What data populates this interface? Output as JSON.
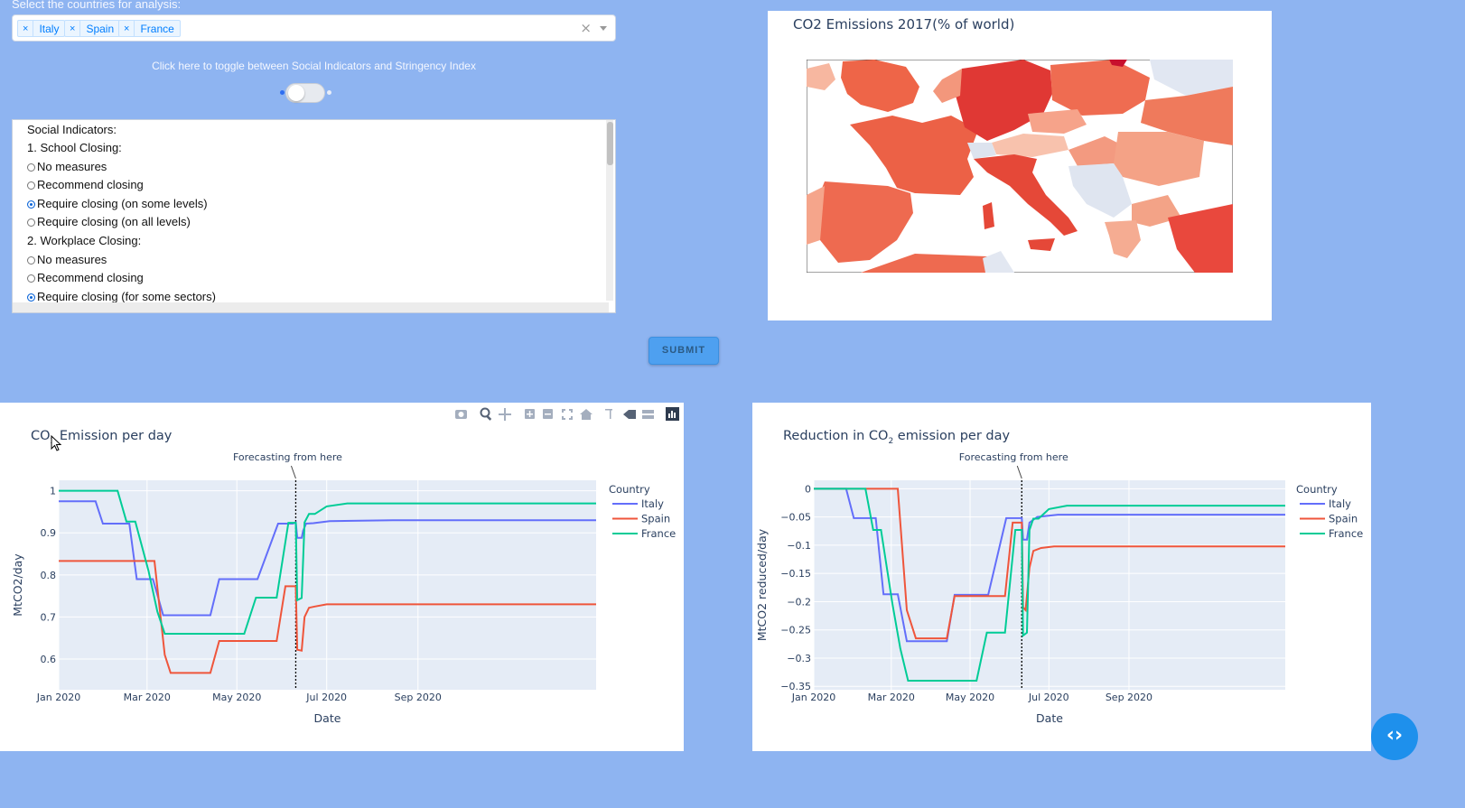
{
  "country_select": {
    "label": "Select the countries for analysis:",
    "tags": [
      "Italy",
      "Spain",
      "France"
    ],
    "remove_glyph": "×",
    "clear_glyph": "×"
  },
  "toggle": {
    "label": "Click here to toggle between Social Indicators and Stringency Index",
    "on": false
  },
  "indicators": {
    "heading": "Social Indicators:",
    "groups": [
      {
        "title": "1. School Closing:",
        "options": [
          "No measures",
          "Recommend closing",
          "Require closing (on some levels)",
          "Require closing (on all levels)"
        ],
        "selected": 2
      },
      {
        "title": "2. Workplace Closing:",
        "options": [
          "No measures",
          "Recommend closing",
          "Require closing (for some sectors)"
        ],
        "selected": 2
      }
    ]
  },
  "submit_label": "SUBMIT",
  "map": {
    "title": "CO2 Emissions 2017(% of world)",
    "colorscale": [
      "#fbe0d4",
      "#f7a98d",
      "#f06a50",
      "#e03b32"
    ]
  },
  "toolbar_icons": [
    "camera-icon",
    "zoom-icon",
    "pan-icon",
    "zoom-in-icon",
    "zoom-out-icon",
    "autoscale-icon",
    "home-icon",
    "spike-lines-icon",
    "hover-closest-icon",
    "hover-compare-icon",
    "plotly-logo-icon"
  ],
  "fab_label": "‹›",
  "chart_data": [
    {
      "type": "line",
      "title_pre": "CO",
      "title_sub": "2",
      "title_post": " Emission per day",
      "xlabel": "Date",
      "ylabel": "MtCO2/day",
      "xlim": [
        "2020-01-01",
        "2020-12-31"
      ],
      "ylim": [
        0.527,
        1.025
      ],
      "yticks": [
        0.6,
        0.7,
        0.8,
        0.9,
        1
      ],
      "ytick_labels": [
        "0.6",
        "0.7",
        "0.8",
        "0.9",
        "1"
      ],
      "xticks": [
        "2020-01-01",
        "2020-03-01",
        "2020-05-01",
        "2020-07-01",
        "2020-09-01"
      ],
      "xtick_labels": [
        "Jan 2020",
        "Mar 2020",
        "May 2020",
        "Jul 2020",
        "Sep 2020"
      ],
      "annotation": {
        "text": "Forecasting from here",
        "x": "2020-06-10"
      },
      "legend_title": "Country",
      "legend_position": "top-right",
      "series": [
        {
          "name": "Italy",
          "color": "#636efa",
          "points": [
            [
              "2020-01-01",
              0.975
            ],
            [
              "2020-01-26",
              0.975
            ],
            [
              "2020-01-31",
              0.922
            ],
            [
              "2020-02-18",
              0.922
            ],
            [
              "2020-02-23",
              0.79
            ],
            [
              "2020-03-05",
              0.79
            ],
            [
              "2020-03-12",
              0.704
            ],
            [
              "2020-04-13",
              0.704
            ],
            [
              "2020-04-19",
              0.79
            ],
            [
              "2020-05-15",
              0.79
            ],
            [
              "2020-05-29",
              0.922
            ],
            [
              "2020-06-08",
              0.922
            ],
            [
              "2020-06-10",
              0.925
            ],
            [
              "2020-06-11",
              0.888
            ],
            [
              "2020-06-14",
              0.888
            ],
            [
              "2020-06-15",
              0.905
            ],
            [
              "2020-06-17",
              0.922
            ],
            [
              "2020-06-22",
              0.923
            ],
            [
              "2020-07-03",
              0.928
            ],
            [
              "2020-08-15",
              0.93
            ],
            [
              "2020-12-31",
              0.93
            ]
          ]
        },
        {
          "name": "Spain",
          "color": "#ef553b",
          "points": [
            [
              "2020-01-01",
              0.833
            ],
            [
              "2020-03-06",
              0.833
            ],
            [
              "2020-03-13",
              0.61
            ],
            [
              "2020-03-17",
              0.567
            ],
            [
              "2020-04-13",
              0.567
            ],
            [
              "2020-04-19",
              0.643
            ],
            [
              "2020-05-28",
              0.643
            ],
            [
              "2020-06-03",
              0.773
            ],
            [
              "2020-06-10",
              0.773
            ],
            [
              "2020-06-11",
              0.622
            ],
            [
              "2020-06-14",
              0.62
            ],
            [
              "2020-06-16",
              0.7
            ],
            [
              "2020-06-19",
              0.722
            ],
            [
              "2020-06-23",
              0.725
            ],
            [
              "2020-07-01",
              0.73
            ],
            [
              "2020-12-31",
              0.73
            ]
          ]
        },
        {
          "name": "France",
          "color": "#00cc96",
          "points": [
            [
              "2020-01-01",
              1.0
            ],
            [
              "2020-02-10",
              1.0
            ],
            [
              "2020-02-16",
              0.927
            ],
            [
              "2020-02-22",
              0.927
            ],
            [
              "2020-03-02",
              0.81
            ],
            [
              "2020-03-08",
              0.713
            ],
            [
              "2020-03-13",
              0.66
            ],
            [
              "2020-05-06",
              0.66
            ],
            [
              "2020-05-14",
              0.746
            ],
            [
              "2020-05-28",
              0.746
            ],
            [
              "2020-06-05",
              0.924
            ],
            [
              "2020-06-10",
              0.924
            ],
            [
              "2020-06-11",
              0.74
            ],
            [
              "2020-06-14",
              0.745
            ],
            [
              "2020-06-16",
              0.925
            ],
            [
              "2020-06-19",
              0.945
            ],
            [
              "2020-06-23",
              0.945
            ],
            [
              "2020-07-01",
              0.963
            ],
            [
              "2020-07-15",
              0.97
            ],
            [
              "2020-12-31",
              0.97
            ]
          ]
        }
      ]
    },
    {
      "type": "line",
      "title_pre": "Reduction in CO",
      "title_sub": "2",
      "title_post": " emission per day",
      "xlabel": "Date",
      "ylabel": "MtCO2 reduced/day",
      "xlim": [
        "2020-01-01",
        "2020-12-31"
      ],
      "ylim": [
        -0.356,
        0.015
      ],
      "yticks": [
        -0.35,
        -0.3,
        -0.25,
        -0.2,
        -0.15,
        -0.1,
        -0.05,
        0
      ],
      "ytick_labels": [
        "−0.35",
        "−0.3",
        "−0.25",
        "−0.2",
        "−0.15",
        "−0.1",
        "−0.05",
        "0"
      ],
      "xticks": [
        "2020-01-01",
        "2020-03-01",
        "2020-05-01",
        "2020-07-01",
        "2020-09-01"
      ],
      "xtick_labels": [
        "Jan 2020",
        "Mar 2020",
        "May 2020",
        "Jul 2020",
        "Sep 2020"
      ],
      "annotation": {
        "text": "Forecasting from here",
        "x": "2020-06-10"
      },
      "legend_title": "Country",
      "legend_position": "top-right",
      "series": [
        {
          "name": "Italy",
          "color": "#636efa",
          "points": [
            [
              "2020-01-01",
              0
            ],
            [
              "2020-01-26",
              0
            ],
            [
              "2020-02-01",
              -0.052
            ],
            [
              "2020-02-18",
              -0.052
            ],
            [
              "2020-02-24",
              -0.187
            ],
            [
              "2020-03-06",
              -0.187
            ],
            [
              "2020-03-13",
              -0.27
            ],
            [
              "2020-04-13",
              -0.27
            ],
            [
              "2020-04-19",
              -0.188
            ],
            [
              "2020-05-15",
              -0.188
            ],
            [
              "2020-05-29",
              -0.052
            ],
            [
              "2020-06-10",
              -0.052
            ],
            [
              "2020-06-11",
              -0.09
            ],
            [
              "2020-06-14",
              -0.09
            ],
            [
              "2020-06-16",
              -0.06
            ],
            [
              "2020-06-22",
              -0.05
            ],
            [
              "2020-07-08",
              -0.046
            ],
            [
              "2020-12-31",
              -0.046
            ]
          ]
        },
        {
          "name": "Spain",
          "color": "#ef553b",
          "points": [
            [
              "2020-01-01",
              0
            ],
            [
              "2020-03-06",
              0
            ],
            [
              "2020-03-13",
              -0.215
            ],
            [
              "2020-03-20",
              -0.265
            ],
            [
              "2020-04-13",
              -0.265
            ],
            [
              "2020-04-19",
              -0.19
            ],
            [
              "2020-05-28",
              -0.19
            ],
            [
              "2020-06-03",
              -0.06
            ],
            [
              "2020-06-10",
              -0.06
            ],
            [
              "2020-06-11",
              -0.21
            ],
            [
              "2020-06-13",
              -0.215
            ],
            [
              "2020-06-16",
              -0.14
            ],
            [
              "2020-06-19",
              -0.11
            ],
            [
              "2020-06-25",
              -0.105
            ],
            [
              "2020-07-05",
              -0.102
            ],
            [
              "2020-12-31",
              -0.102
            ]
          ]
        },
        {
          "name": "France",
          "color": "#00cc96",
          "points": [
            [
              "2020-01-01",
              0
            ],
            [
              "2020-02-10",
              0
            ],
            [
              "2020-02-16",
              -0.073
            ],
            [
              "2020-02-22",
              -0.073
            ],
            [
              "2020-03-02",
              -0.205
            ],
            [
              "2020-03-08",
              -0.283
            ],
            [
              "2020-03-14",
              -0.34
            ],
            [
              "2020-05-06",
              -0.34
            ],
            [
              "2020-05-14",
              -0.255
            ],
            [
              "2020-05-28",
              -0.255
            ],
            [
              "2020-06-05",
              -0.073
            ],
            [
              "2020-06-10",
              -0.073
            ],
            [
              "2020-06-11",
              -0.26
            ],
            [
              "2020-06-14",
              -0.255
            ],
            [
              "2020-06-16",
              -0.073
            ],
            [
              "2020-06-19",
              -0.053
            ],
            [
              "2020-06-23",
              -0.053
            ],
            [
              "2020-07-01",
              -0.036
            ],
            [
              "2020-07-15",
              -0.03
            ],
            [
              "2020-12-31",
              -0.03
            ]
          ]
        }
      ]
    }
  ]
}
